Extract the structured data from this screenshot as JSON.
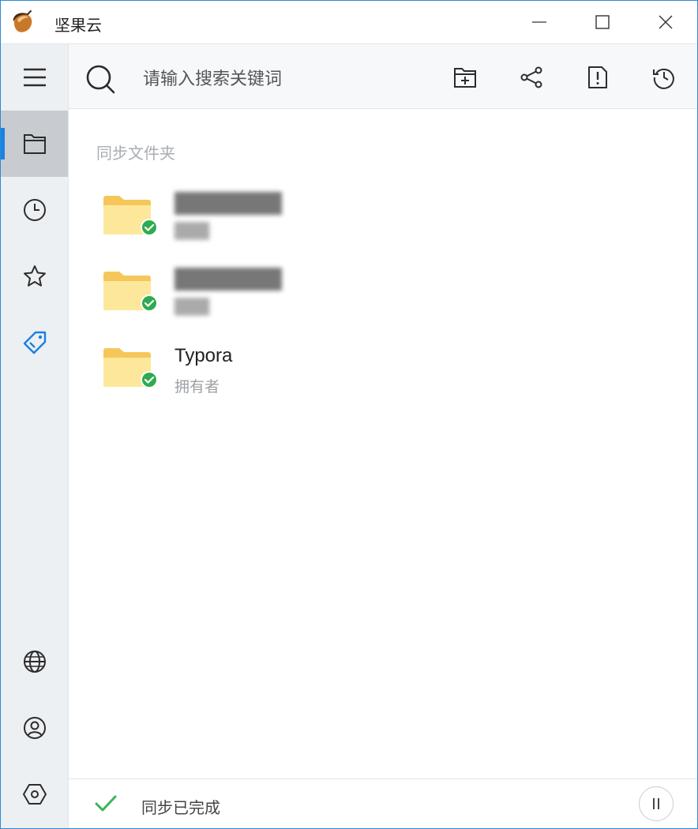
{
  "window": {
    "title": "坚果云",
    "controls": [
      "minimize",
      "maximize",
      "close"
    ]
  },
  "sidebar": {
    "items": [
      {
        "name": "menu",
        "icon": "menu-icon",
        "active": false
      },
      {
        "name": "files",
        "icon": "folder-icon",
        "active": true
      },
      {
        "name": "recent",
        "icon": "clock-icon",
        "active": false
      },
      {
        "name": "starred",
        "icon": "star-icon",
        "active": false
      },
      {
        "name": "tags",
        "icon": "tag-icon",
        "active": false
      },
      {
        "name": "web",
        "icon": "globe-icon",
        "active": false
      },
      {
        "name": "account",
        "icon": "user-icon",
        "active": false
      },
      {
        "name": "settings",
        "icon": "settings-hex-icon",
        "active": false
      }
    ],
    "accent_color": "#1a82e2"
  },
  "toolbar": {
    "search_placeholder": "请输入搜索关键词",
    "buttons": [
      "new-folder-icon",
      "share-icon",
      "report-icon",
      "history-icon"
    ]
  },
  "main": {
    "section_title": "同步文件夹",
    "folders": [
      {
        "name": "████████",
        "sub": "███",
        "blurred": true,
        "synced": true
      },
      {
        "name": "████████",
        "sub": "███",
        "blurred": true,
        "synced": true
      },
      {
        "name": "Typora",
        "sub": "拥有者",
        "blurred": false,
        "synced": true
      }
    ]
  },
  "status": {
    "text": "同步已完成",
    "check_color": "#3cb55a"
  }
}
